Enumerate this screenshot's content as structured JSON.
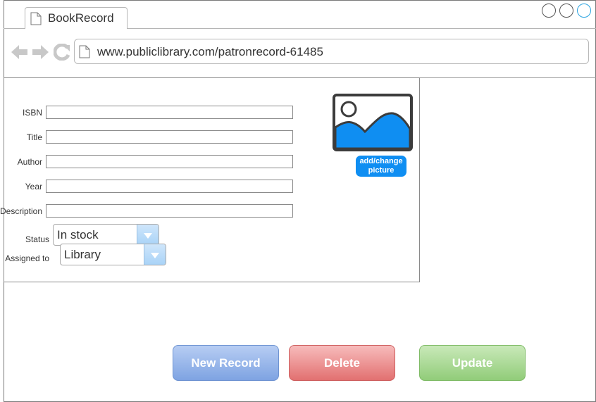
{
  "browser": {
    "tab_title": "BookRecord",
    "url": "www.publiclibrary.com/patronrecord-61485"
  },
  "form": {
    "fields": [
      {
        "label": "ISBN",
        "value": ""
      },
      {
        "label": "Title",
        "value": ""
      },
      {
        "label": "Author",
        "value": ""
      },
      {
        "label": "Year",
        "value": ""
      },
      {
        "label": "Description",
        "value": ""
      }
    ],
    "status": {
      "label": "Status",
      "value": "In stock"
    },
    "assigned": {
      "label": "Assigned to",
      "value": "Library"
    }
  },
  "picture": {
    "button_label_line1": "add/change",
    "button_label_line2": "picture"
  },
  "actions": {
    "new": "New Record",
    "delete": "Delete",
    "update": "Update"
  },
  "colors": {
    "accent": "#0f8ef2",
    "new": "#7ea3e2",
    "delete": "#e27070",
    "update": "#91cc79"
  }
}
